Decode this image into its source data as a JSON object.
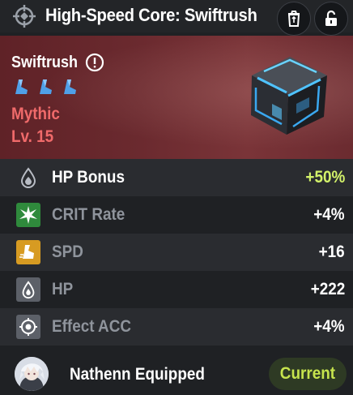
{
  "header": {
    "title": "High-Speed Core: Swiftrush",
    "icon": "target-reticle-icon",
    "buttons": [
      {
        "name": "recycle-button",
        "icon": "recycle-trash-icon"
      },
      {
        "name": "lock-button",
        "icon": "unlocked-padlock-icon"
      }
    ]
  },
  "item": {
    "name": "Swiftrush",
    "info_icon": "exclamation-circle-icon",
    "set_icons": [
      "boot-icon",
      "boot-icon",
      "boot-icon"
    ],
    "rarity": "Mythic",
    "level": "Lv. 15",
    "image": "blue-glowing-cube"
  },
  "main_stat": {
    "name": "HP Bonus",
    "value": "+50%",
    "icon": "droplet-icon"
  },
  "sub_stats": [
    {
      "name": "CRIT Rate",
      "value": "+4%",
      "icon": "burst-icon",
      "color": "#2f8a3c"
    },
    {
      "name": "SPD",
      "value": "+16",
      "icon": "speed-boot-icon",
      "color": "#d79b22"
    },
    {
      "name": "HP",
      "value": "+222",
      "icon": "droplet-icon",
      "color": "#5c6068"
    },
    {
      "name": "Effect ACC",
      "value": "+4%",
      "icon": "crosshair-icon",
      "color": "#5c6068"
    }
  ],
  "footer": {
    "owner": "Nathenn",
    "equipped_text": "Nathenn  Equipped",
    "current_label": "Current"
  },
  "colors": {
    "rarity": "#f06a6a",
    "main_value": "#d3f26a",
    "current": "#c6e34d",
    "banner": "#6b2a2f"
  }
}
